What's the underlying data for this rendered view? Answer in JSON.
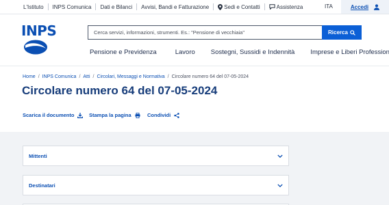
{
  "topbar": {
    "links": [
      "L'Istituto",
      "INPS Comunica",
      "Dati e Bilanci",
      "Avvisi, Bandi e Fatturazione",
      "Sedi e Contatti",
      "Assistenza"
    ],
    "language": "ITA",
    "login_label": "Accedi"
  },
  "logo": {
    "text": "INPS"
  },
  "search": {
    "placeholder": "Cerca servizi, informazioni, strumenti. Es.: \"Pensione di vecchiaia\"",
    "button_label": "Ricerca"
  },
  "mainnav": {
    "items": [
      "Pensione e Previdenza",
      "Lavoro",
      "Sostegni, Sussidi e Indennità",
      "Imprese e Liberi Professionisti"
    ]
  },
  "breadcrumb": {
    "items": [
      "Home",
      "INPS Comunica",
      "Atti",
      "Circolari, Messaggi e Normativa"
    ],
    "current": "Circolare numero 64 del 07-05-2024"
  },
  "page": {
    "title": "Circolare numero 64 del 07-05-2024"
  },
  "actions": {
    "download": "Scarica il documento",
    "print": "Stampa la pagina",
    "share": "Condividi"
  },
  "accordions": [
    "Mittenti",
    "Destinatari"
  ],
  "colors": {
    "accent": "#0b5fd6",
    "link": "#0b4fb3",
    "title": "#163c7a"
  }
}
